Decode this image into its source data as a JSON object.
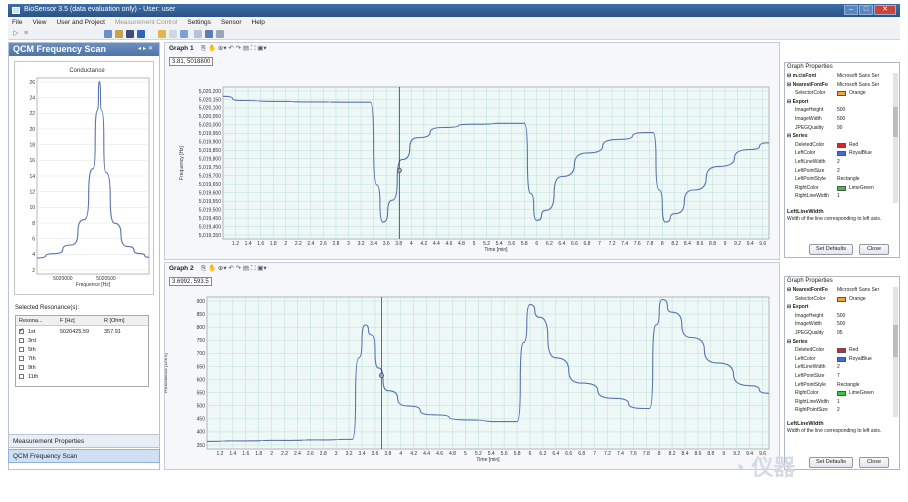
{
  "window": {
    "title": "BioSensor 3.5 (data evaluation only) - User: user"
  },
  "menu": [
    "File",
    "View",
    "User and Project",
    "Measurement Control",
    "Settings",
    "Sensor",
    "Help"
  ],
  "left_panel": {
    "title": "QCM Frequency Scan",
    "conductance_title": "Conductance",
    "conductance_xlabel": "Frequence [Hz]",
    "selected_label": "Selected Resonance(s):",
    "table_headers": [
      "Resona...",
      "F [Hz]",
      "R [Ohm]"
    ],
    "rows": [
      {
        "name": "1st",
        "f": "5020425.59",
        "r": "357.91",
        "checked": true
      },
      {
        "name": "3rd",
        "f": "",
        "r": "",
        "checked": false
      },
      {
        "name": "5th",
        "f": "",
        "r": "",
        "checked": false
      },
      {
        "name": "7th",
        "f": "",
        "r": "",
        "checked": false
      },
      {
        "name": "9th",
        "f": "",
        "r": "",
        "checked": false
      },
      {
        "name": "11th",
        "f": "",
        "r": "",
        "checked": false
      }
    ],
    "nav_measurement": "Measurement Properties",
    "nav_qcm": "QCM Frequency Scan"
  },
  "graph1": {
    "label": "Graph 1",
    "readout": "3.81, 5018800",
    "xlabel": "Time [min]",
    "ylabel": "Frequency [Hz]"
  },
  "graph2": {
    "label": "Graph 2",
    "readout": "3.6992, 593.5",
    "xlabel": "Time [min]",
    "ylabel": "Resistance [Ohm]"
  },
  "prop1": {
    "title": "Graph Properties",
    "rows": [
      {
        "type": "cat",
        "k": "m.cisFont",
        "v": "Microsoft Sans Ser"
      },
      {
        "type": "cat",
        "k": "NearestFontFo",
        "v": "Microsoft Sans Ser"
      },
      {
        "type": "prop",
        "k": "SelectorColor",
        "v": "Orange",
        "color": "#f0a23c"
      },
      {
        "type": "cat",
        "k": "Export",
        "v": ""
      },
      {
        "type": "prop",
        "k": "ImageHeight",
        "v": "500"
      },
      {
        "type": "prop",
        "k": "ImageWidth",
        "v": "500"
      },
      {
        "type": "prop",
        "k": "JPEGQuality",
        "v": "90"
      },
      {
        "type": "cat",
        "k": "Series",
        "v": ""
      },
      {
        "type": "prop",
        "k": "DeletedColor",
        "v": "Red",
        "color": "#d8242b"
      },
      {
        "type": "prop",
        "k": "LeftColor",
        "v": "RoyalBlue",
        "color": "#4169e1"
      },
      {
        "type": "prop",
        "k": "LeftLineWidth",
        "v": "2"
      },
      {
        "type": "prop",
        "k": "LeftPointSize",
        "v": "2"
      },
      {
        "type": "prop",
        "k": "LeftPointStyle",
        "v": "Rectangle"
      },
      {
        "type": "prop",
        "k": "RightColor",
        "v": "LimeGreen",
        "color": "#32cd32"
      },
      {
        "type": "prop",
        "k": "RightLineWidth",
        "v": "1"
      }
    ],
    "desc_title": "LeftLineWidth",
    "desc": "Width of the line corresponding to left axis.",
    "btn_defaults": "Set Defaults",
    "btn_close": "Close"
  },
  "prop2": {
    "title": "Graph Properties",
    "rows": [
      {
        "type": "cat",
        "k": "NearestFontFo",
        "v": "Microsoft Sans Ser"
      },
      {
        "type": "prop",
        "k": "SelectorColor",
        "v": "Orange",
        "color": "#f0a23c"
      },
      {
        "type": "cat",
        "k": "Export",
        "v": ""
      },
      {
        "type": "prop",
        "k": "ImageHeight",
        "v": "500"
      },
      {
        "type": "prop",
        "k": "ImageWidth",
        "v": "500"
      },
      {
        "type": "prop",
        "k": "JPEGQuality",
        "v": "95"
      },
      {
        "type": "cat",
        "k": "Series",
        "v": ""
      },
      {
        "type": "prop",
        "k": "DeletedColor",
        "v": "Red",
        "color": "#d8242b"
      },
      {
        "type": "prop",
        "k": "LeftColor",
        "v": "RoyalBlue",
        "color": "#4169e1"
      },
      {
        "type": "prop",
        "k": "LeftLineWidth",
        "v": "2"
      },
      {
        "type": "prop",
        "k": "LeftPointSize",
        "v": "7"
      },
      {
        "type": "prop",
        "k": "LeftPointStyle",
        "v": "Rectangle"
      },
      {
        "type": "prop",
        "k": "RightColor",
        "v": "LimeGreen",
        "color": "#32cd32"
      },
      {
        "type": "prop",
        "k": "RightLineWidth",
        "v": "1"
      },
      {
        "type": "prop",
        "k": "RightPointSize",
        "v": "2"
      }
    ],
    "desc_title": "LeftLineWidth",
    "desc": "Width of the line corresponding to left axis.",
    "btn_defaults": "Set Defaults",
    "btn_close": "Close"
  },
  "watermark": "仪器",
  "chart_data": [
    {
      "type": "line",
      "title": "Conductance",
      "xlabel": "Frequence [Hz]",
      "ylabel": "",
      "xticks": [
        "5020000",
        "5020500"
      ],
      "yticks": [
        "26",
        "24",
        "22",
        "20",
        "18",
        "16",
        "14",
        "12",
        "10",
        "8",
        "6",
        "4",
        "2"
      ],
      "ylim": [
        0,
        27
      ],
      "xlim": [
        5019700,
        5021000
      ],
      "series": [
        {
          "x": [
            5019700,
            5019900,
            5020100,
            5020250,
            5020350,
            5020400,
            5020425,
            5020450,
            5020500,
            5020600,
            5020750,
            5020900,
            5021000
          ],
          "values": [
            2.2,
            2.8,
            4.0,
            7.5,
            14.5,
            22.5,
            26.5,
            22.5,
            14.0,
            7.0,
            3.8,
            2.8,
            2.3
          ]
        }
      ]
    },
    {
      "type": "line",
      "title": "",
      "xlabel": "Time [min]",
      "ylabel": "Frequency [Hz]",
      "yticks": [
        "5,020,200",
        "5,020,150",
        "5,020,100",
        "5,020,050",
        "5,020,000",
        "5,019,950",
        "5,019,900",
        "5,019,850",
        "5,019,800",
        "5,019,750",
        "5,019,700",
        "5,019,650",
        "5,019,600",
        "5,019,550",
        "5,019,500",
        "5,019,450",
        "5,019,400",
        "5,019,350"
      ],
      "xticks": [
        "1.2",
        "1.4",
        "1.6",
        "1.8",
        "2",
        "2.2",
        "2.4",
        "2.6",
        "2.8",
        "3",
        "3.2",
        "3.4",
        "3.6",
        "3.8",
        "4",
        "4.2",
        "4.4",
        "4.6",
        "4.8",
        "5",
        "5.2",
        "5.4",
        "5.6",
        "5.8",
        "6",
        "6.2",
        "6.4",
        "6.6",
        "6.8",
        "7",
        "7.2",
        "7.4",
        "7.6",
        "7.8",
        "8",
        "8.2",
        "8.4",
        "8.6",
        "8.8",
        "9",
        "9.2",
        "9.4",
        "9.6"
      ],
      "xlim": [
        1.0,
        9.7
      ],
      "ylim": [
        5019330,
        5020230
      ],
      "cursor_x": 3.81,
      "series": [
        {
          "x": [
            1.0,
            1.3,
            1.8,
            2.4,
            3.0,
            3.35,
            3.45,
            3.55,
            3.7,
            3.85,
            4.1,
            4.5,
            5.0,
            5.6,
            5.8,
            5.9,
            6.0,
            6.15,
            6.4,
            6.8,
            7.3,
            7.75,
            7.85,
            7.95,
            8.05,
            8.2,
            8.5,
            8.9,
            9.4,
            9.7
          ],
          "values": [
            5020175,
            5020150,
            5020145,
            5020142,
            5020140,
            5020140,
            5019650,
            5019430,
            5019560,
            5019800,
            5019930,
            5019990,
            5020010,
            5020015,
            5020015,
            5019600,
            5019440,
            5019500,
            5019700,
            5019840,
            5019920,
            5019960,
            5019960,
            5019620,
            5019430,
            5019480,
            5019620,
            5019760,
            5019860,
            5019900
          ]
        }
      ]
    },
    {
      "type": "line",
      "title": "",
      "xlabel": "Time [min]",
      "ylabel": "Resistance [Ohm]",
      "yticks": [
        "900",
        "850",
        "800",
        "750",
        "700",
        "650",
        "600",
        "550",
        "500",
        "450",
        "400",
        "350"
      ],
      "xticks": [
        "1.2",
        "1.4",
        "1.6",
        "1.8",
        "2",
        "2.2",
        "2.4",
        "2.6",
        "2.8",
        "3",
        "3.2",
        "3.4",
        "3.6",
        "3.8",
        "4",
        "4.2",
        "4.4",
        "4.6",
        "4.8",
        "5",
        "5.2",
        "5.4",
        "5.6",
        "5.8",
        "6",
        "6.2",
        "6.4",
        "6.6",
        "6.8",
        "7",
        "7.2",
        "7.4",
        "7.6",
        "7.8",
        "8",
        "8.2",
        "8.4",
        "8.6",
        "8.8",
        "9",
        "9.2",
        "9.4",
        "9.6"
      ],
      "xlim": [
        1.0,
        9.7
      ],
      "ylim": [
        340,
        940
      ],
      "cursor_x": 3.7,
      "series": [
        {
          "x": [
            1.0,
            1.5,
            2.2,
            2.8,
            3.25,
            3.35,
            3.45,
            3.55,
            3.65,
            3.8,
            4.1,
            4.5,
            5.0,
            5.6,
            5.8,
            5.9,
            6.0,
            6.15,
            6.4,
            6.8,
            7.3,
            7.75,
            7.85,
            7.95,
            8.05,
            8.2,
            8.5,
            8.9,
            9.4,
            9.7
          ],
          "values": [
            370,
            372,
            374,
            376,
            378,
            700,
            830,
            790,
            660,
            570,
            510,
            475,
            455,
            448,
            448,
            760,
            910,
            860,
            700,
            600,
            540,
            500,
            500,
            830,
            930,
            880,
            780,
            680,
            590,
            560
          ]
        }
      ]
    }
  ]
}
